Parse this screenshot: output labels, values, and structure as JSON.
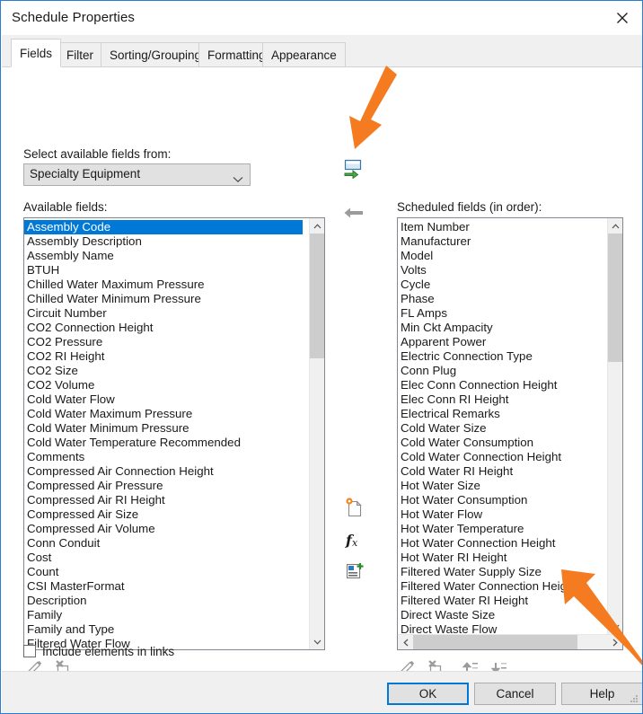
{
  "window": {
    "title": "Schedule Properties",
    "close_icon": "close-icon"
  },
  "tabs": [
    {
      "label": "Fields",
      "active": true
    },
    {
      "label": "Filter",
      "active": false
    },
    {
      "label": "Sorting/Grouping",
      "active": false
    },
    {
      "label": "Formatting",
      "active": false
    },
    {
      "label": "Appearance",
      "active": false
    }
  ],
  "fields_tab": {
    "select_from_label": "Select available fields from:",
    "category_combo": {
      "value": "Specialty Equipment",
      "icon": "chevron-down-icon"
    },
    "available": {
      "label": "Available fields:",
      "selected_index": 0,
      "items": [
        "Assembly Code",
        "Assembly Description",
        "Assembly Name",
        "BTUH",
        "Chilled Water Maximum Pressure",
        "Chilled Water Minimum Pressure",
        "Circuit Number",
        "CO2 Connection Height",
        "CO2 Pressure",
        "CO2 RI Height",
        "CO2 Size",
        "CO2 Volume",
        "Cold Water Flow",
        "Cold Water Maximum Pressure",
        "Cold Water Minimum Pressure",
        "Cold Water Temperature Recommended",
        "Comments",
        "Compressed Air Connection Height",
        "Compressed Air Pressure",
        "Compressed Air RI Height",
        "Compressed Air Size",
        "Compressed Air Volume",
        "Conn Conduit",
        "Cost",
        "Count",
        "CSI MasterFormat",
        "Description",
        "Family",
        "Family and Type",
        "Filtered Water Flow"
      ]
    },
    "scheduled": {
      "label": "Scheduled fields (in order):",
      "items": [
        "Item Number",
        "Manufacturer",
        "Model",
        "Volts",
        "Cycle",
        "Phase",
        "FL Amps",
        "Min Ckt Ampacity",
        "Apparent Power",
        "Electric Connection Type",
        "Conn Plug",
        "Elec Conn Connection Height",
        "Elec Conn RI Height",
        "Electrical Remarks",
        "Cold Water Size",
        "Cold Water Consumption",
        "Cold Water Connection Height",
        "Cold Water RI Height",
        "Hot Water Size",
        "Hot Water Consumption",
        "Hot Water Flow",
        "Hot Water Temperature",
        "Hot Water Connection Height",
        "Hot Water RI Height",
        "Filtered Water Supply Size",
        "Filtered Water Connection Height",
        "Filtered Water RI Height",
        "Direct Waste Size",
        "Direct Waste Flow"
      ]
    },
    "transfer_buttons": [
      {
        "name": "add-field-button",
        "icon": "add-parameter-arrow-right-icon"
      },
      {
        "name": "remove-field-button",
        "icon": "arrow-left-icon"
      }
    ],
    "parameter_buttons": [
      {
        "name": "add-parameter-button",
        "icon": "new-parameter-icon"
      },
      {
        "name": "calculated-value-button",
        "icon": "fx-icon"
      },
      {
        "name": "combine-parameters-button",
        "icon": "combine-parameters-icon"
      }
    ],
    "available_toolbar": [
      {
        "name": "edit-available-button",
        "icon": "pencil-icon"
      },
      {
        "name": "delete-available-button",
        "icon": "delete-field-icon"
      }
    ],
    "scheduled_toolbar": [
      {
        "name": "edit-scheduled-button",
        "icon": "pencil-icon"
      },
      {
        "name": "delete-scheduled-button",
        "icon": "delete-field-icon"
      },
      {
        "name": "move-up-button",
        "icon": "move-up-icon"
      },
      {
        "name": "move-down-button",
        "icon": "move-down-icon"
      }
    ],
    "include_links": {
      "label": "Include elements in links",
      "checked": false
    }
  },
  "footer": {
    "ok": "OK",
    "cancel": "Cancel",
    "help": "Help"
  },
  "annotations": [
    {
      "name": "arrow-to-add-field-button",
      "color": "#F57B20"
    },
    {
      "name": "arrow-to-horizontal-scroll-right",
      "color": "#F57B20"
    }
  ],
  "colors": {
    "accent": "#0078d7",
    "annotation": "#F57B20",
    "window_border": "#2b7dd1",
    "panel_bg": "#f0f0f0",
    "listbox_border": "#828790",
    "scroll_thumb": "#cdcdcd"
  }
}
